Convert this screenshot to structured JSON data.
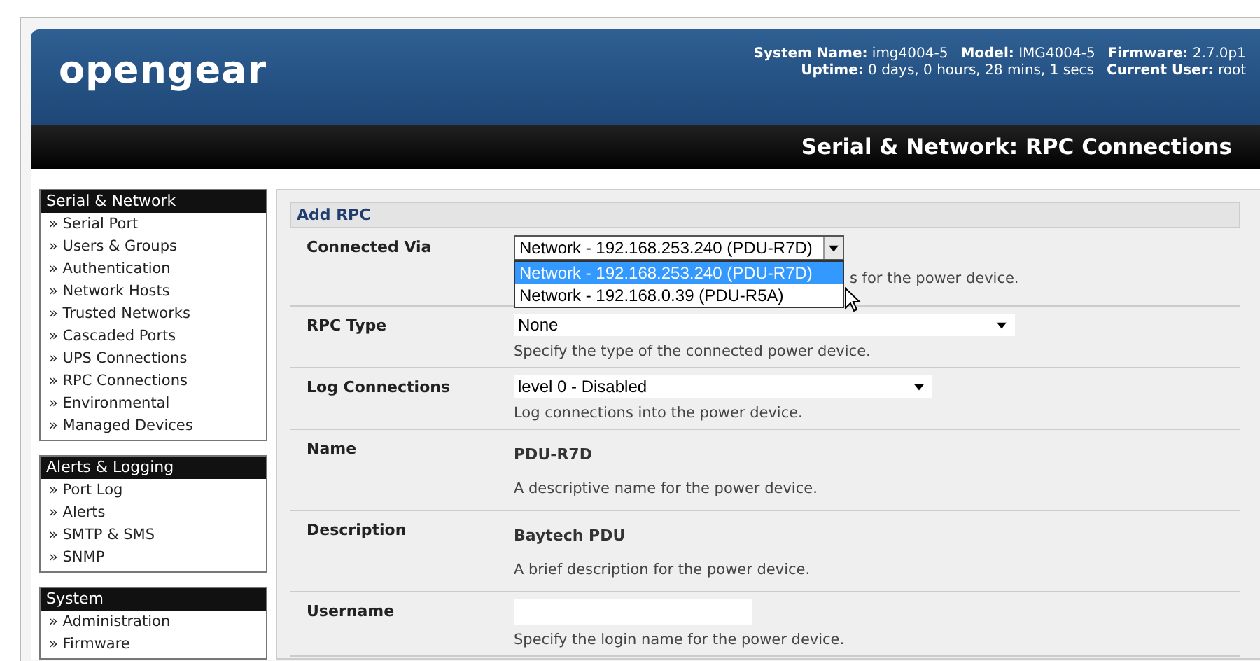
{
  "header": {
    "logo": "opengear",
    "info_lines": [
      [
        {
          "label": "System Name:",
          "value": "img4004-5"
        },
        {
          "label": "Model:",
          "value": "IMG4004-5"
        },
        {
          "label": "Firmware:",
          "value": "2.7.0p1"
        }
      ],
      [
        {
          "label": "Uptime:",
          "value": "0 days, 0 hours, 28 mins, 1 secs"
        },
        {
          "label": "Current User:",
          "value": "root"
        }
      ]
    ]
  },
  "page_title": "Serial & Network: RPC Connections",
  "sidebar": {
    "sections": [
      {
        "title": "Serial & Network",
        "items": [
          "» Serial Port",
          "» Users & Groups",
          "» Authentication",
          "» Network Hosts",
          "» Trusted Networks",
          "» Cascaded Ports",
          "» UPS Connections",
          "» RPC Connections",
          "» Environmental",
          "» Managed Devices"
        ]
      },
      {
        "title": "Alerts & Logging",
        "items": [
          "» Port Log",
          "» Alerts",
          "» SMTP & SMS",
          "» SNMP"
        ]
      },
      {
        "title": "System",
        "items": [
          "» Administration",
          "» Firmware"
        ]
      }
    ]
  },
  "form": {
    "title": "Add RPC",
    "rows": [
      {
        "kind": "select",
        "label": "Connected Via",
        "value": "Network - 192.168.253.240 (PDU-R7D)",
        "hint": "s for the power device.",
        "dropdown": [
          {
            "label": "Network - 192.168.253.240 (PDU-R7D)",
            "selected": true
          },
          {
            "label": "Network - 192.168.0.39 (PDU-R5A)",
            "selected": false
          }
        ]
      },
      {
        "kind": "select",
        "label": "RPC Type",
        "value": "None",
        "hint": "Specify the type of the connected power device."
      },
      {
        "kind": "select",
        "label": "Log Connections",
        "value": "level 0 - Disabled",
        "hint": "Log connections into the power device."
      },
      {
        "kind": "text",
        "label": "Name",
        "value": "PDU-R7D",
        "hint": "A descriptive name for the power device."
      },
      {
        "kind": "text",
        "label": "Description",
        "value": "Baytech PDU",
        "hint": "A brief description for the power device."
      },
      {
        "kind": "input",
        "label": "Username",
        "hint": "Specify the login name for the power device."
      }
    ]
  }
}
